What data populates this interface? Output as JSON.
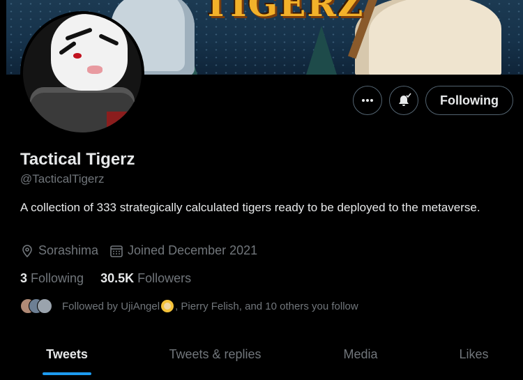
{
  "banner": {
    "title": "TIGERZ"
  },
  "profile": {
    "name": "Tactical Tigerz",
    "handle": "@TacticalTigerz",
    "bio": "A collection of 333 strategically calculated tigers ready to be deployed to the metaverse.",
    "location": "Sorashima",
    "joined": "Joined December 2021"
  },
  "actions": {
    "more_icon": "more-horizontal-icon",
    "notify_icon": "bell-check-icon",
    "follow_label": "Following"
  },
  "stats": {
    "following_count": "3",
    "following_label": "Following",
    "followers_count": "30.5K",
    "followers_label": "Followers"
  },
  "followed_by": {
    "prefix": "Followed by UjiAngel",
    "suffix": ", Pierry Felish, and 10 others you follow"
  },
  "tabs": [
    {
      "label": "Tweets",
      "active": true
    },
    {
      "label": "Tweets & replies",
      "active": false
    },
    {
      "label": "Media",
      "active": false
    },
    {
      "label": "Likes",
      "active": false
    }
  ],
  "colors": {
    "accent": "#1d9bf0",
    "text": "#e7e9ea",
    "muted": "#71767b",
    "border": "#536471"
  }
}
